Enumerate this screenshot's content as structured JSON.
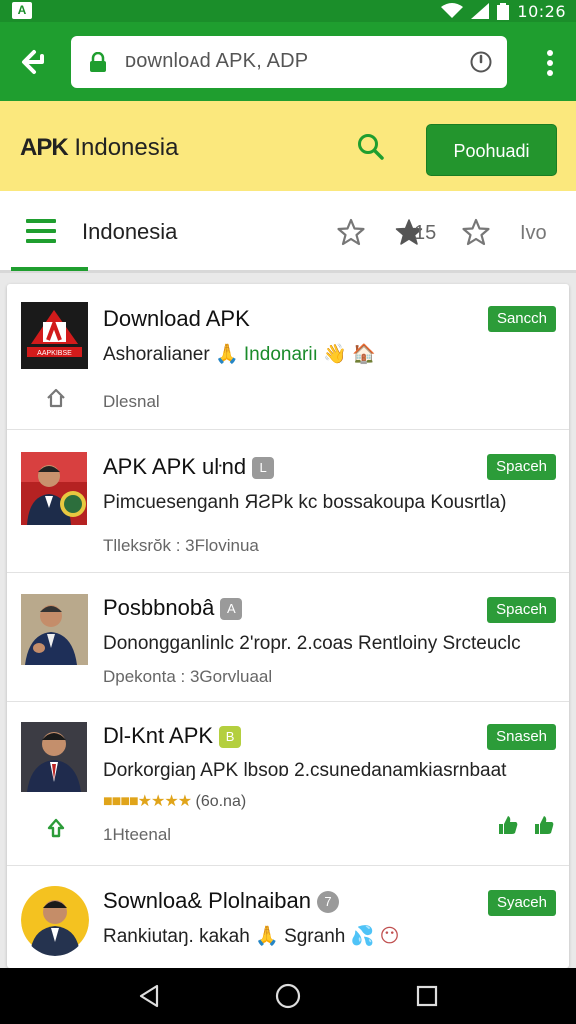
{
  "status_bar": {
    "time": "10:26",
    "icons": [
      "app-icon",
      "wifi-icon",
      "signal-icon",
      "battery-icon"
    ]
  },
  "browser": {
    "url_text": "ᴅownloᴀd APK, ADP"
  },
  "header": {
    "brand_logo": "APK",
    "brand_text": "Indonesia",
    "download_button": "Poohuadi"
  },
  "tabs": {
    "title": "Indonesia",
    "count": "15",
    "more": "Ivo"
  },
  "items": [
    {
      "name": "Download APK",
      "desc_prefix": "Ashoralianer",
      "desc_highlight": "Indonariı",
      "meta": "Dlesnal",
      "badge": "Sancch",
      "thumb_label": "AAPKIBSE"
    },
    {
      "name": "APK APK uŀnd",
      "tag": "L",
      "desc": "Pimcuesenganh ЯƧPk kc bossakoupa Kousrtla)",
      "meta": "Tlleksrŏk : 3Flovinua",
      "badge": "Spaceh"
    },
    {
      "name": "Posbbnobâ",
      "tag": "A",
      "desc": "Donongganlinlc 2'ropr. 2.coas Rentloiny Srcteuclc",
      "meta": "Dpekonta : 3Gorvluaal",
      "badge": "Spaceh"
    },
    {
      "name": "Dl-Knt APK",
      "tag": "B",
      "desc": "Dorkorgiaŋ APK lbsoɒ 2.csunedanamkiasrnbaat",
      "rating_text": "(6o.na)",
      "meta": "1Hteenal",
      "badge": "Snaseh"
    },
    {
      "name": "Sownloa& Plolnaiban",
      "tag": "7",
      "desc": "Rankiutaŋ. kakah",
      "desc_extra": "Sgranh",
      "badge": "Syaceh"
    }
  ],
  "colors": {
    "brand_green": "#1f9e2f",
    "status_green": "#1b8e2a",
    "header_yellow": "#fbe87d",
    "badge_green": "#2c9c39"
  }
}
